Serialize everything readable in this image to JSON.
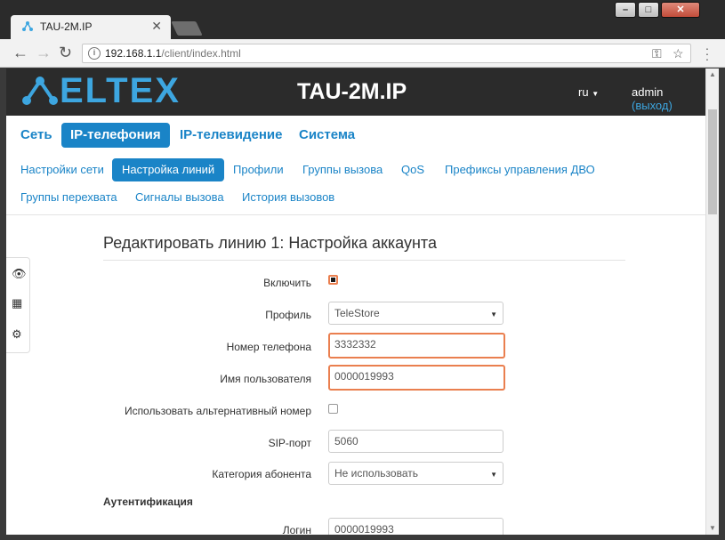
{
  "browser": {
    "tab_title": "TAU-2M.IP",
    "tab_close": "✕",
    "url_host": "192.168.1.1",
    "url_path": "/client/index.html",
    "back": "←",
    "forward": "→",
    "reload": "↻",
    "win_min": "–",
    "win_max": "□",
    "win_close": "✕",
    "info_icon": "i",
    "key_icon": "⚿",
    "star_icon": "☆"
  },
  "header": {
    "logo": "ELTEX",
    "device": "TAU-2M.IP",
    "lang": "ru",
    "user": "admin",
    "logout": "(выход)"
  },
  "main_tabs": [
    {
      "label": "Сеть",
      "active": false
    },
    {
      "label": "IP-телефония",
      "active": true
    },
    {
      "label": "IP-телевидение",
      "active": false
    },
    {
      "label": "Система",
      "active": false
    }
  ],
  "sub_tabs": [
    {
      "label": "Настройки сети",
      "active": false
    },
    {
      "label": "Настройка линий",
      "active": true
    },
    {
      "label": "Профили",
      "active": false
    },
    {
      "label": "Группы вызова",
      "active": false
    },
    {
      "label": "QoS",
      "active": false
    },
    {
      "label": "Префиксы управления ДВО",
      "active": false
    },
    {
      "label": "Группы перехвата",
      "active": false
    },
    {
      "label": "Сигналы вызова",
      "active": false
    },
    {
      "label": "История вызовов",
      "active": false
    }
  ],
  "side_icons": [
    "eye-icon",
    "grid-icon",
    "gear-icon"
  ],
  "side_glyphs": {
    "eye": "👁",
    "grid": "▦",
    "gear": "⚙"
  },
  "form": {
    "title": "Редактировать линию 1: Настройка аккаунта",
    "enable": {
      "label": "Включить",
      "checked": true
    },
    "profile": {
      "label": "Профиль",
      "value": "TeleStore"
    },
    "phone": {
      "label": "Номер телефона",
      "value": "3332332"
    },
    "username": {
      "label": "Имя пользователя",
      "value": "0000019993"
    },
    "alt_number": {
      "label": "Использовать альтернативный номер",
      "checked": false
    },
    "sip_port": {
      "label": "SIP-порт",
      "value": "5060"
    },
    "category": {
      "label": "Категория абонента",
      "value": "Не использовать"
    },
    "auth_section": "Аутентификация",
    "login": {
      "label": "Логин",
      "value": "0000019993"
    }
  },
  "colors": {
    "accent": "#1a84c7",
    "highlight": "#ea7f4f",
    "header_bg": "#2b2b2b"
  }
}
